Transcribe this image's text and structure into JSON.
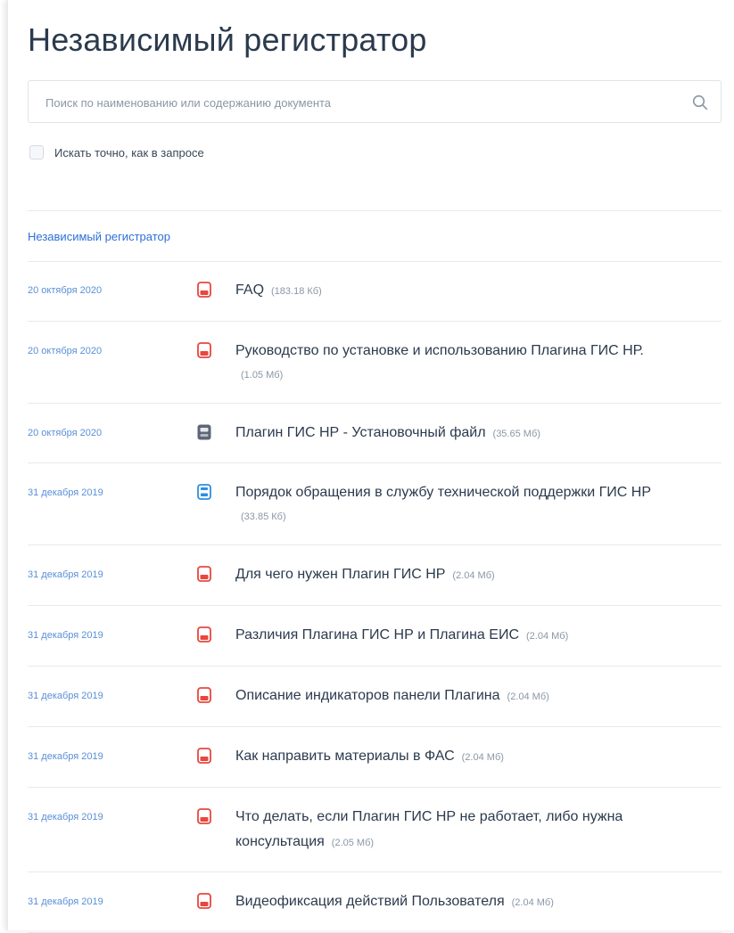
{
  "page": {
    "title": "Независимый регистратор"
  },
  "search": {
    "placeholder": "Поиск по наименованию или содержанию документа",
    "value": "",
    "icon": "search-icon"
  },
  "exact_match": {
    "label": "Искать точно, как в запросе",
    "checked": false
  },
  "breadcrumb": {
    "label": "Независимый регистратор"
  },
  "colors": {
    "accent": "#2e6fd6",
    "pdf": "#e8473e",
    "doc": "#2f8fe0",
    "exe": "#5c6677"
  },
  "documents": [
    {
      "date": "20 октября 2020",
      "type": "pdf",
      "title": "FAQ",
      "size": "(183.18 Кб)"
    },
    {
      "date": "20 октября 2020",
      "type": "pdf",
      "title": "Руководство по установке и использованию Плагина ГИС НР.",
      "size": "(1.05 Мб)"
    },
    {
      "date": "20 октября 2020",
      "type": "exe",
      "title": "Плагин ГИС НР - Установочный файл",
      "size": "(35.65 Мб)"
    },
    {
      "date": "31 декабря 2019",
      "type": "doc",
      "title": "Порядок обращения в службу технической поддержки ГИС НР",
      "size": "(33.85 Кб)"
    },
    {
      "date": "31 декабря 2019",
      "type": "pdf",
      "title": "Для чего нужен Плагин ГИС НР",
      "size": "(2.04 Мб)"
    },
    {
      "date": "31 декабря 2019",
      "type": "pdf",
      "title": "Различия Плагина ГИС НР и Плагина ЕИС",
      "size": "(2.04 Мб)"
    },
    {
      "date": "31 декабря 2019",
      "type": "pdf",
      "title": "Описание индикаторов панели Плагина",
      "size": "(2.04 Мб)"
    },
    {
      "date": "31 декабря 2019",
      "type": "pdf",
      "title": "Как направить материалы в ФАС",
      "size": "(2.04 Мб)"
    },
    {
      "date": "31 декабря 2019",
      "type": "pdf",
      "title": "Что делать, если Плагин ГИС НР не работает, либо нужна консультация",
      "size": "(2.05 Мб)"
    },
    {
      "date": "31 декабря 2019",
      "type": "pdf",
      "title": "Видеофиксация действий Пользователя",
      "size": "(2.04 Мб)"
    }
  ]
}
